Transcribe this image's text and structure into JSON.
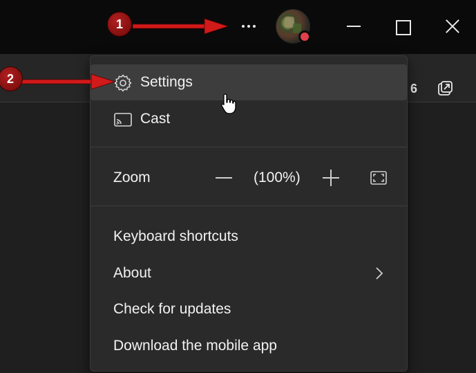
{
  "titlebar": {
    "more_icon": "more-horizontal-icon",
    "presence_color": "#e0404c",
    "window_controls": [
      "minimize-icon",
      "maximize-icon",
      "close-icon"
    ]
  },
  "background": {
    "partial_text": "6",
    "popout_icon": "pop-out-icon"
  },
  "menu": {
    "settings": {
      "label": "Settings",
      "icon": "gear-icon"
    },
    "cast": {
      "label": "Cast",
      "icon": "cast-icon"
    },
    "zoom": {
      "label": "Zoom",
      "value": "(100%)"
    },
    "keyboard_shortcuts": {
      "label": "Keyboard shortcuts"
    },
    "about": {
      "label": "About"
    },
    "check_updates": {
      "label": "Check for updates"
    },
    "mobile_app": {
      "label": "Download the mobile app"
    }
  },
  "annotations": {
    "step1": "1",
    "step2": "2",
    "color": "#b22020"
  }
}
